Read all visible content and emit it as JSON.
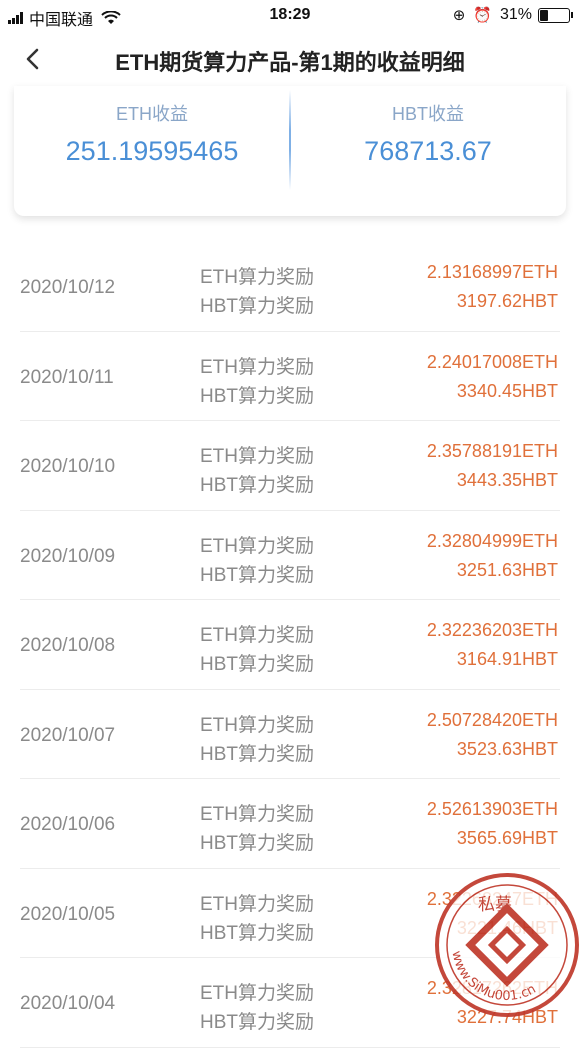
{
  "status_bar": {
    "carrier": "中国联通",
    "time": "18:29",
    "battery_percent_text": "31%",
    "battery_level": 0.31
  },
  "nav": {
    "title": "ETH期货算力产品-第1期的收益明细"
  },
  "summary": {
    "eth_label": "ETH收益",
    "eth_value": "251.19595465",
    "hbt_label": "HBT收益",
    "hbt_value": "768713.67"
  },
  "records": [
    {
      "date": "2020/10/12",
      "eth_label": "ETH算力奖励",
      "hbt_label": "HBT算力奖励",
      "eth_value": "2.13168997ETH",
      "hbt_value": "3197.62HBT"
    },
    {
      "date": "2020/10/11",
      "eth_label": "ETH算力奖励",
      "hbt_label": "HBT算力奖励",
      "eth_value": "2.24017008ETH",
      "hbt_value": "3340.45HBT"
    },
    {
      "date": "2020/10/10",
      "eth_label": "ETH算力奖励",
      "hbt_label": "HBT算力奖励",
      "eth_value": "2.35788191ETH",
      "hbt_value": "3443.35HBT"
    },
    {
      "date": "2020/10/09",
      "eth_label": "ETH算力奖励",
      "hbt_label": "HBT算力奖励",
      "eth_value": "2.32804999ETH",
      "hbt_value": "3251.63HBT"
    },
    {
      "date": "2020/10/08",
      "eth_label": "ETH算力奖励",
      "hbt_label": "HBT算力奖励",
      "eth_value": "2.32236203ETH",
      "hbt_value": "3164.91HBT"
    },
    {
      "date": "2020/10/07",
      "eth_label": "ETH算力奖励",
      "hbt_label": "HBT算力奖励",
      "eth_value": "2.50728420ETH",
      "hbt_value": "3523.63HBT"
    },
    {
      "date": "2020/10/06",
      "eth_label": "ETH算力奖励",
      "hbt_label": "HBT算力奖励",
      "eth_value": "2.52613903ETH",
      "hbt_value": "3565.69HBT"
    },
    {
      "date": "2020/10/05",
      "eth_label": "ETH算力奖励",
      "hbt_label": "HBT算力奖励",
      "eth_value": "2.32268247ETH",
      "hbt_value": "3221.46HBT"
    },
    {
      "date": "2020/10/04",
      "eth_label": "ETH算力奖励",
      "hbt_label": "HBT算力奖励",
      "eth_value": "2.32817262ETH",
      "hbt_value": "3227.74HBT"
    }
  ],
  "watermark": {
    "text": "www.SiMu001.cn",
    "chars": "私募",
    "color": "#c0392b"
  },
  "colors": {
    "accent_blue": "#4a8fd6",
    "value_orange": "#e0703a",
    "label_gray": "#8a8a8a"
  }
}
